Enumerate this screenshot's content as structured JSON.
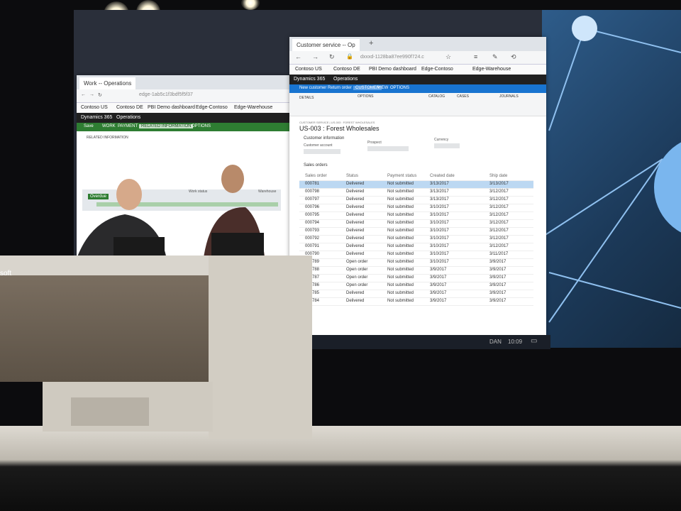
{
  "left_window": {
    "tab_title": "Work -- Operations",
    "address": "edge-1ab5c1f3bdf5f5f37",
    "favorites": [
      "Contoso US",
      "Contoso DE",
      "PBI Demo dashboard",
      "Edge-Contoso",
      "Edge-Warehouse"
    ],
    "app_name": "Dynamics 365",
    "module": "Operations",
    "ribbon": [
      "Save",
      "WORK",
      "PAYMENT",
      "RELATED INFORMATION",
      "OPTIONS"
    ],
    "section_title": "RELATED INFORMATION",
    "table_headers": [
      "Work status",
      "Warehouse"
    ],
    "overdue_label": "Overdue"
  },
  "right_window": {
    "tab_title": "Customer service -- Op",
    "address": "dxxxd-1128ba87ee990f724.c",
    "favorites": [
      "Contoso US",
      "Contoso DE",
      "PBI Demo dashboard",
      "Edge-Contoso",
      "Edge-Warehouse"
    ],
    "app_name": "Dynamics 365",
    "module": "Operations",
    "ribbon": [
      "New customer",
      "Return order",
      "CUSTOMER",
      "VIEW",
      "OPTIONS"
    ],
    "ribbon_groups": [
      "DETAILS",
      "OPTIONS",
      "CATALOG",
      "CASES",
      "JOURNALS"
    ],
    "breadcrumb": "CUSTOMER SERVICE | US-003 : FOREST WHOLESALES",
    "page_title": "US-003 : Forest Wholesales",
    "customer_info_label": "Customer information",
    "fields": [
      "Customer account",
      "Prospect",
      "Currency"
    ],
    "sales_orders_label": "Sales orders",
    "columns": [
      "Sales order",
      "Status",
      "Payment status",
      "Created date",
      "Ship date"
    ],
    "rows": [
      {
        "order": "000781",
        "status": "Delivered",
        "payment": "Not submitted",
        "created": "3/13/2017",
        "ship": "3/13/2017"
      },
      {
        "order": "000798",
        "status": "Delivered",
        "payment": "Not submitted",
        "created": "3/13/2017",
        "ship": "3/12/2017"
      },
      {
        "order": "000797",
        "status": "Delivered",
        "payment": "Not submitted",
        "created": "3/13/2017",
        "ship": "3/12/2017"
      },
      {
        "order": "000796",
        "status": "Delivered",
        "payment": "Not submitted",
        "created": "3/10/2017",
        "ship": "3/12/2017"
      },
      {
        "order": "000795",
        "status": "Delivered",
        "payment": "Not submitted",
        "created": "3/10/2017",
        "ship": "3/12/2017"
      },
      {
        "order": "000794",
        "status": "Delivered",
        "payment": "Not submitted",
        "created": "3/10/2017",
        "ship": "3/12/2017"
      },
      {
        "order": "000793",
        "status": "Delivered",
        "payment": "Not submitted",
        "created": "3/10/2017",
        "ship": "3/12/2017"
      },
      {
        "order": "000792",
        "status": "Delivered",
        "payment": "Not submitted",
        "created": "3/10/2017",
        "ship": "3/12/2017"
      },
      {
        "order": "000791",
        "status": "Delivered",
        "payment": "Not submitted",
        "created": "3/10/2017",
        "ship": "3/12/2017"
      },
      {
        "order": "000790",
        "status": "Delivered",
        "payment": "Not submitted",
        "created": "3/10/2017",
        "ship": "3/11/2017"
      },
      {
        "order": "000789",
        "status": "Open order",
        "payment": "Not submitted",
        "created": "3/10/2017",
        "ship": "3/9/2017"
      },
      {
        "order": "000788",
        "status": "Open order",
        "payment": "Not submitted",
        "created": "3/9/2017",
        "ship": "3/9/2017"
      },
      {
        "order": "000787",
        "status": "Open order",
        "payment": "Not submitted",
        "created": "3/9/2017",
        "ship": "3/9/2017"
      },
      {
        "order": "000786",
        "status": "Open order",
        "payment": "Not submitted",
        "created": "3/9/2017",
        "ship": "3/9/2017"
      },
      {
        "order": "000785",
        "status": "Delivered",
        "payment": "Not submitted",
        "created": "3/9/2017",
        "ship": "3/9/2017"
      },
      {
        "order": "000784",
        "status": "Delivered",
        "payment": "Not submitted",
        "created": "3/9/2017",
        "ship": "3/9/2017"
      }
    ]
  },
  "taskbar": {
    "lang": "DAN",
    "time": "10:09"
  },
  "desk_logo": "soft",
  "colors": {
    "accent_blue": "#1874d0",
    "accent_green": "#2e7d32",
    "stage": "#dedad2"
  }
}
